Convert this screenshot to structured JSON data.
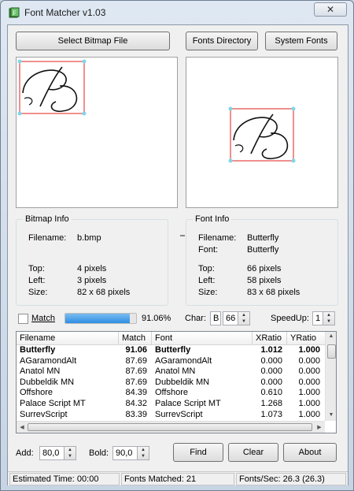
{
  "window": {
    "title": "Font Matcher v1.03",
    "close_label": "✕"
  },
  "toolbar": {
    "select_bitmap": "Select Bitmap File",
    "fonts_directory": "Fonts Directory",
    "system_fonts": "System Fonts"
  },
  "bitmap_info": {
    "title": "Bitmap Info",
    "filename_label": "Filename:",
    "filename": "b.bmp",
    "top_label": "Top:",
    "top": "4 pixels",
    "left_label": "Left:",
    "left": "3 pixels",
    "size_label": "Size:",
    "size": "82 x 68 pixels"
  },
  "font_info": {
    "title": "Font Info",
    "filename_label": "Filename:",
    "filename": "Butterfly",
    "font_label": "Font:",
    "font": "Butterfly",
    "top_label": "Top:",
    "top": "66 pixels",
    "left_label": "Left:",
    "left": "58 pixels",
    "size_label": "Size:",
    "size": "83 x 68 pixels"
  },
  "match_row": {
    "match_label": "Match",
    "progress_percent": 91.06,
    "progress_text": "91.06%",
    "char_label": "Char:",
    "char_value": "B",
    "char_code": "66",
    "speedup_label": "SpeedUp:",
    "speedup_value": "1"
  },
  "table": {
    "columns": [
      "Filename",
      "Match",
      "Font",
      "XRatio",
      "YRatio"
    ],
    "rows": [
      {
        "filename": "Butterfly",
        "match": "91.06",
        "font": "Butterfly",
        "xratio": "1.012",
        "yratio": "1.000",
        "bold": true
      },
      {
        "filename": "AGaramondAlt",
        "match": "87.69",
        "font": "AGaramondAlt",
        "xratio": "0.000",
        "yratio": "0.000"
      },
      {
        "filename": "Anatol MN",
        "match": "87.69",
        "font": "Anatol MN",
        "xratio": "0.000",
        "yratio": "0.000"
      },
      {
        "filename": "Dubbeldik MN",
        "match": "87.69",
        "font": "Dubbeldik MN",
        "xratio": "0.000",
        "yratio": "0.000"
      },
      {
        "filename": "Offshore",
        "match": "84.39",
        "font": "Offshore",
        "xratio": "0.610",
        "yratio": "1.000"
      },
      {
        "filename": "Palace Script MT",
        "match": "84.32",
        "font": "Palace Script MT",
        "xratio": "1.268",
        "yratio": "1.000"
      },
      {
        "filename": "SurrevScript",
        "match": "83.39",
        "font": "SurrevScript",
        "xratio": "1.073",
        "yratio": "1.000"
      }
    ]
  },
  "bottom": {
    "add_label": "Add:",
    "add_value": "80,0",
    "bold_label": "Bold:",
    "bold_value": "90,0",
    "find": "Find",
    "clear": "Clear",
    "about": "About"
  },
  "status": {
    "estimated_time": "Estimated Time: 00:00",
    "fonts_matched": "Fonts Matched: 21",
    "fonts_per_sec": "Fonts/Sec: 26.3 (26.3)"
  },
  "colors": {
    "match_box": "#e0201b",
    "corner_marker": "#7fd6e8",
    "progress": "#3a93e6"
  },
  "icons": {
    "app": "font-matcher-app-icon",
    "close": "close-icon"
  }
}
